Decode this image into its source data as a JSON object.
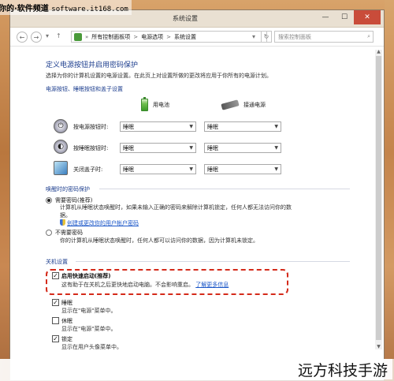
{
  "watermark": {
    "text": "你的·软件频道",
    "url": "software.it168.com"
  },
  "window": {
    "title": "系统设置",
    "close": "✕",
    "minimize": "—",
    "maximize": "☐"
  },
  "address": {
    "back": "←",
    "forward": "→",
    "up": "↑",
    "dropdown": "▾",
    "root": "»",
    "crumbs": [
      "所有控制面板项",
      "电源选项",
      "系统设置"
    ],
    "seps": [
      ">",
      ">"
    ],
    "refresh": "↻",
    "search_placeholder": "搜索控制面板",
    "search_icon": "⌕"
  },
  "main": {
    "heading": "定义电源按钮并启用密码保护",
    "subtext": "选择为你的计算机设置的电源设置。在此页上对设置所做的更改将应用于你所有的电源计划。"
  },
  "power_buttons": {
    "title": "电源按钮、睡眠按钮和盖子设置",
    "col_battery": "用电池",
    "col_plugged": "接通电源",
    "rows": [
      {
        "label": "按电源按钮时:",
        "battery": "睡眠",
        "plugged": "睡眠"
      },
      {
        "label": "按睡眠按钮时:",
        "battery": "睡眠",
        "plugged": "睡眠"
      },
      {
        "label": "关闭盖子时:",
        "battery": "睡眠",
        "plugged": "睡眠"
      }
    ]
  },
  "wake_password": {
    "title": "唤醒时的密码保护",
    "require_label": "需要密码(推荐)",
    "require_desc1": "计算机从睡眠状态唤醒时，如果未输入正确的密码来解除计算机锁定，任何人都无法访问你的数",
    "require_desc2": "据。",
    "require_link": "创建或更改你的用户帐户密码",
    "norequire_label": "不需要密码",
    "norequire_desc": "你的计算机从睡眠状态唤醒时，任何人都可以访问你的数据，因为计算机未锁定。"
  },
  "shutdown": {
    "title": "关机设置",
    "items": [
      {
        "label": "启用快速启动(推荐)",
        "desc": "这有助于在关机之后更快地启动电脑。不会影响重启。",
        "link": "了解更多信息",
        "checked": true
      },
      {
        "label": "睡眠",
        "desc": "显示在\"电源\"菜单中。",
        "checked": true
      },
      {
        "label": "休眠",
        "desc": "显示在\"电源\"菜单中。",
        "checked": false
      },
      {
        "label": "锁定",
        "desc": "显示在用户头像菜单中。",
        "checked": true
      }
    ]
  },
  "brand": "远方科技手游"
}
